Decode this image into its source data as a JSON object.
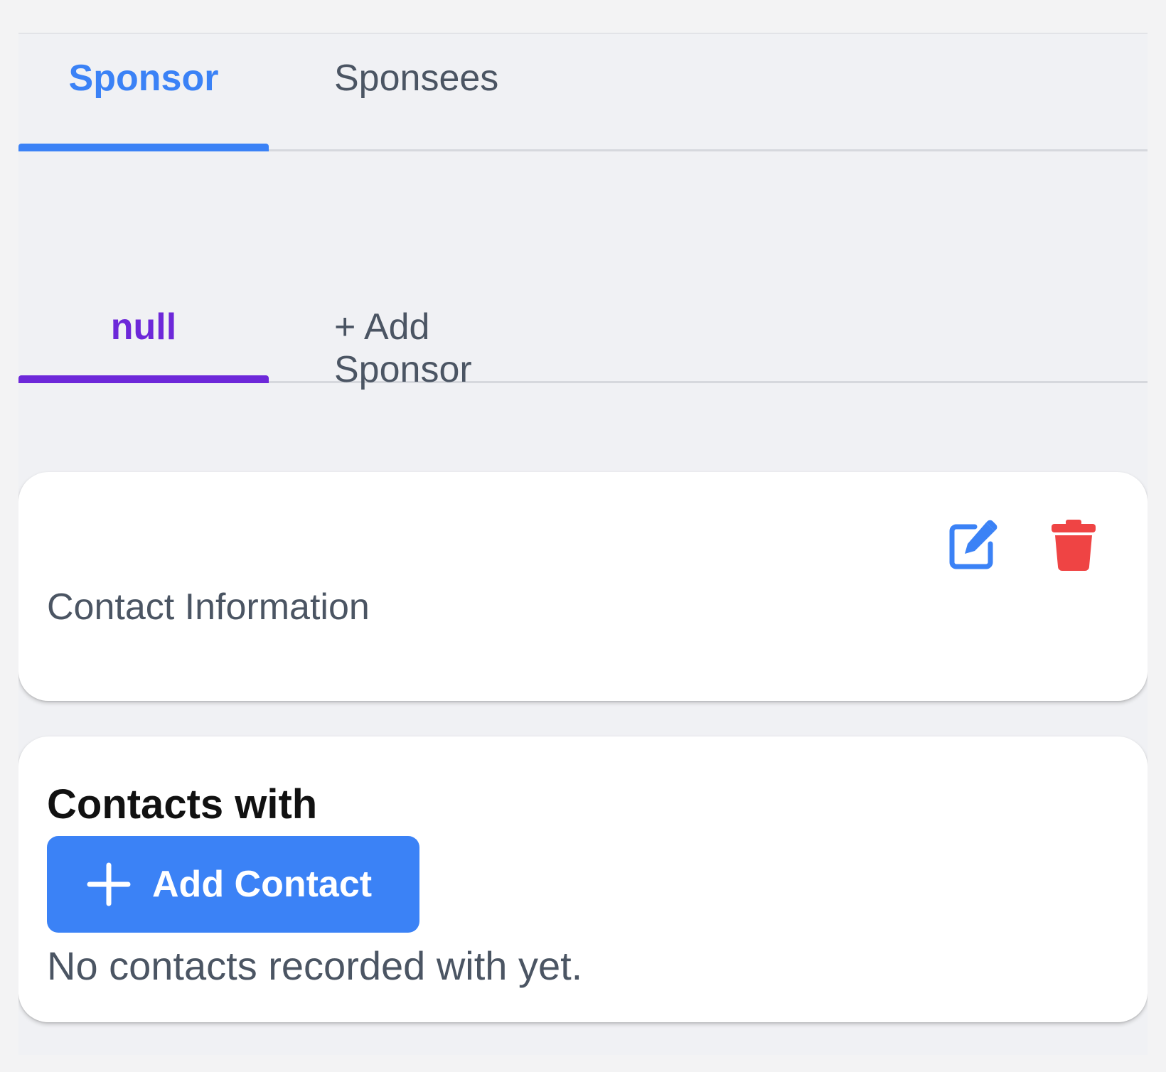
{
  "primary_tabs": [
    {
      "label": "Sponsor",
      "active": true
    },
    {
      "label": "Sponsees",
      "active": false
    }
  ],
  "sponsor_tabs": [
    {
      "label": "null",
      "active": true
    },
    {
      "label": "+ Add Sponsor",
      "active": false
    }
  ],
  "contact_card": {
    "section_label": "Contact Information",
    "edit_icon": "edit-icon",
    "delete_icon": "trash-icon"
  },
  "contacts_card": {
    "title": "Contacts with",
    "add_button_label": "Add Contact",
    "add_button_icon": "plus-icon",
    "empty_message": "No contacts recorded with yet."
  },
  "colors": {
    "primary_blue": "#3b82f6",
    "accent_purple": "#6d28d9",
    "danger_red": "#ef4444",
    "muted_text": "#4b5563"
  }
}
